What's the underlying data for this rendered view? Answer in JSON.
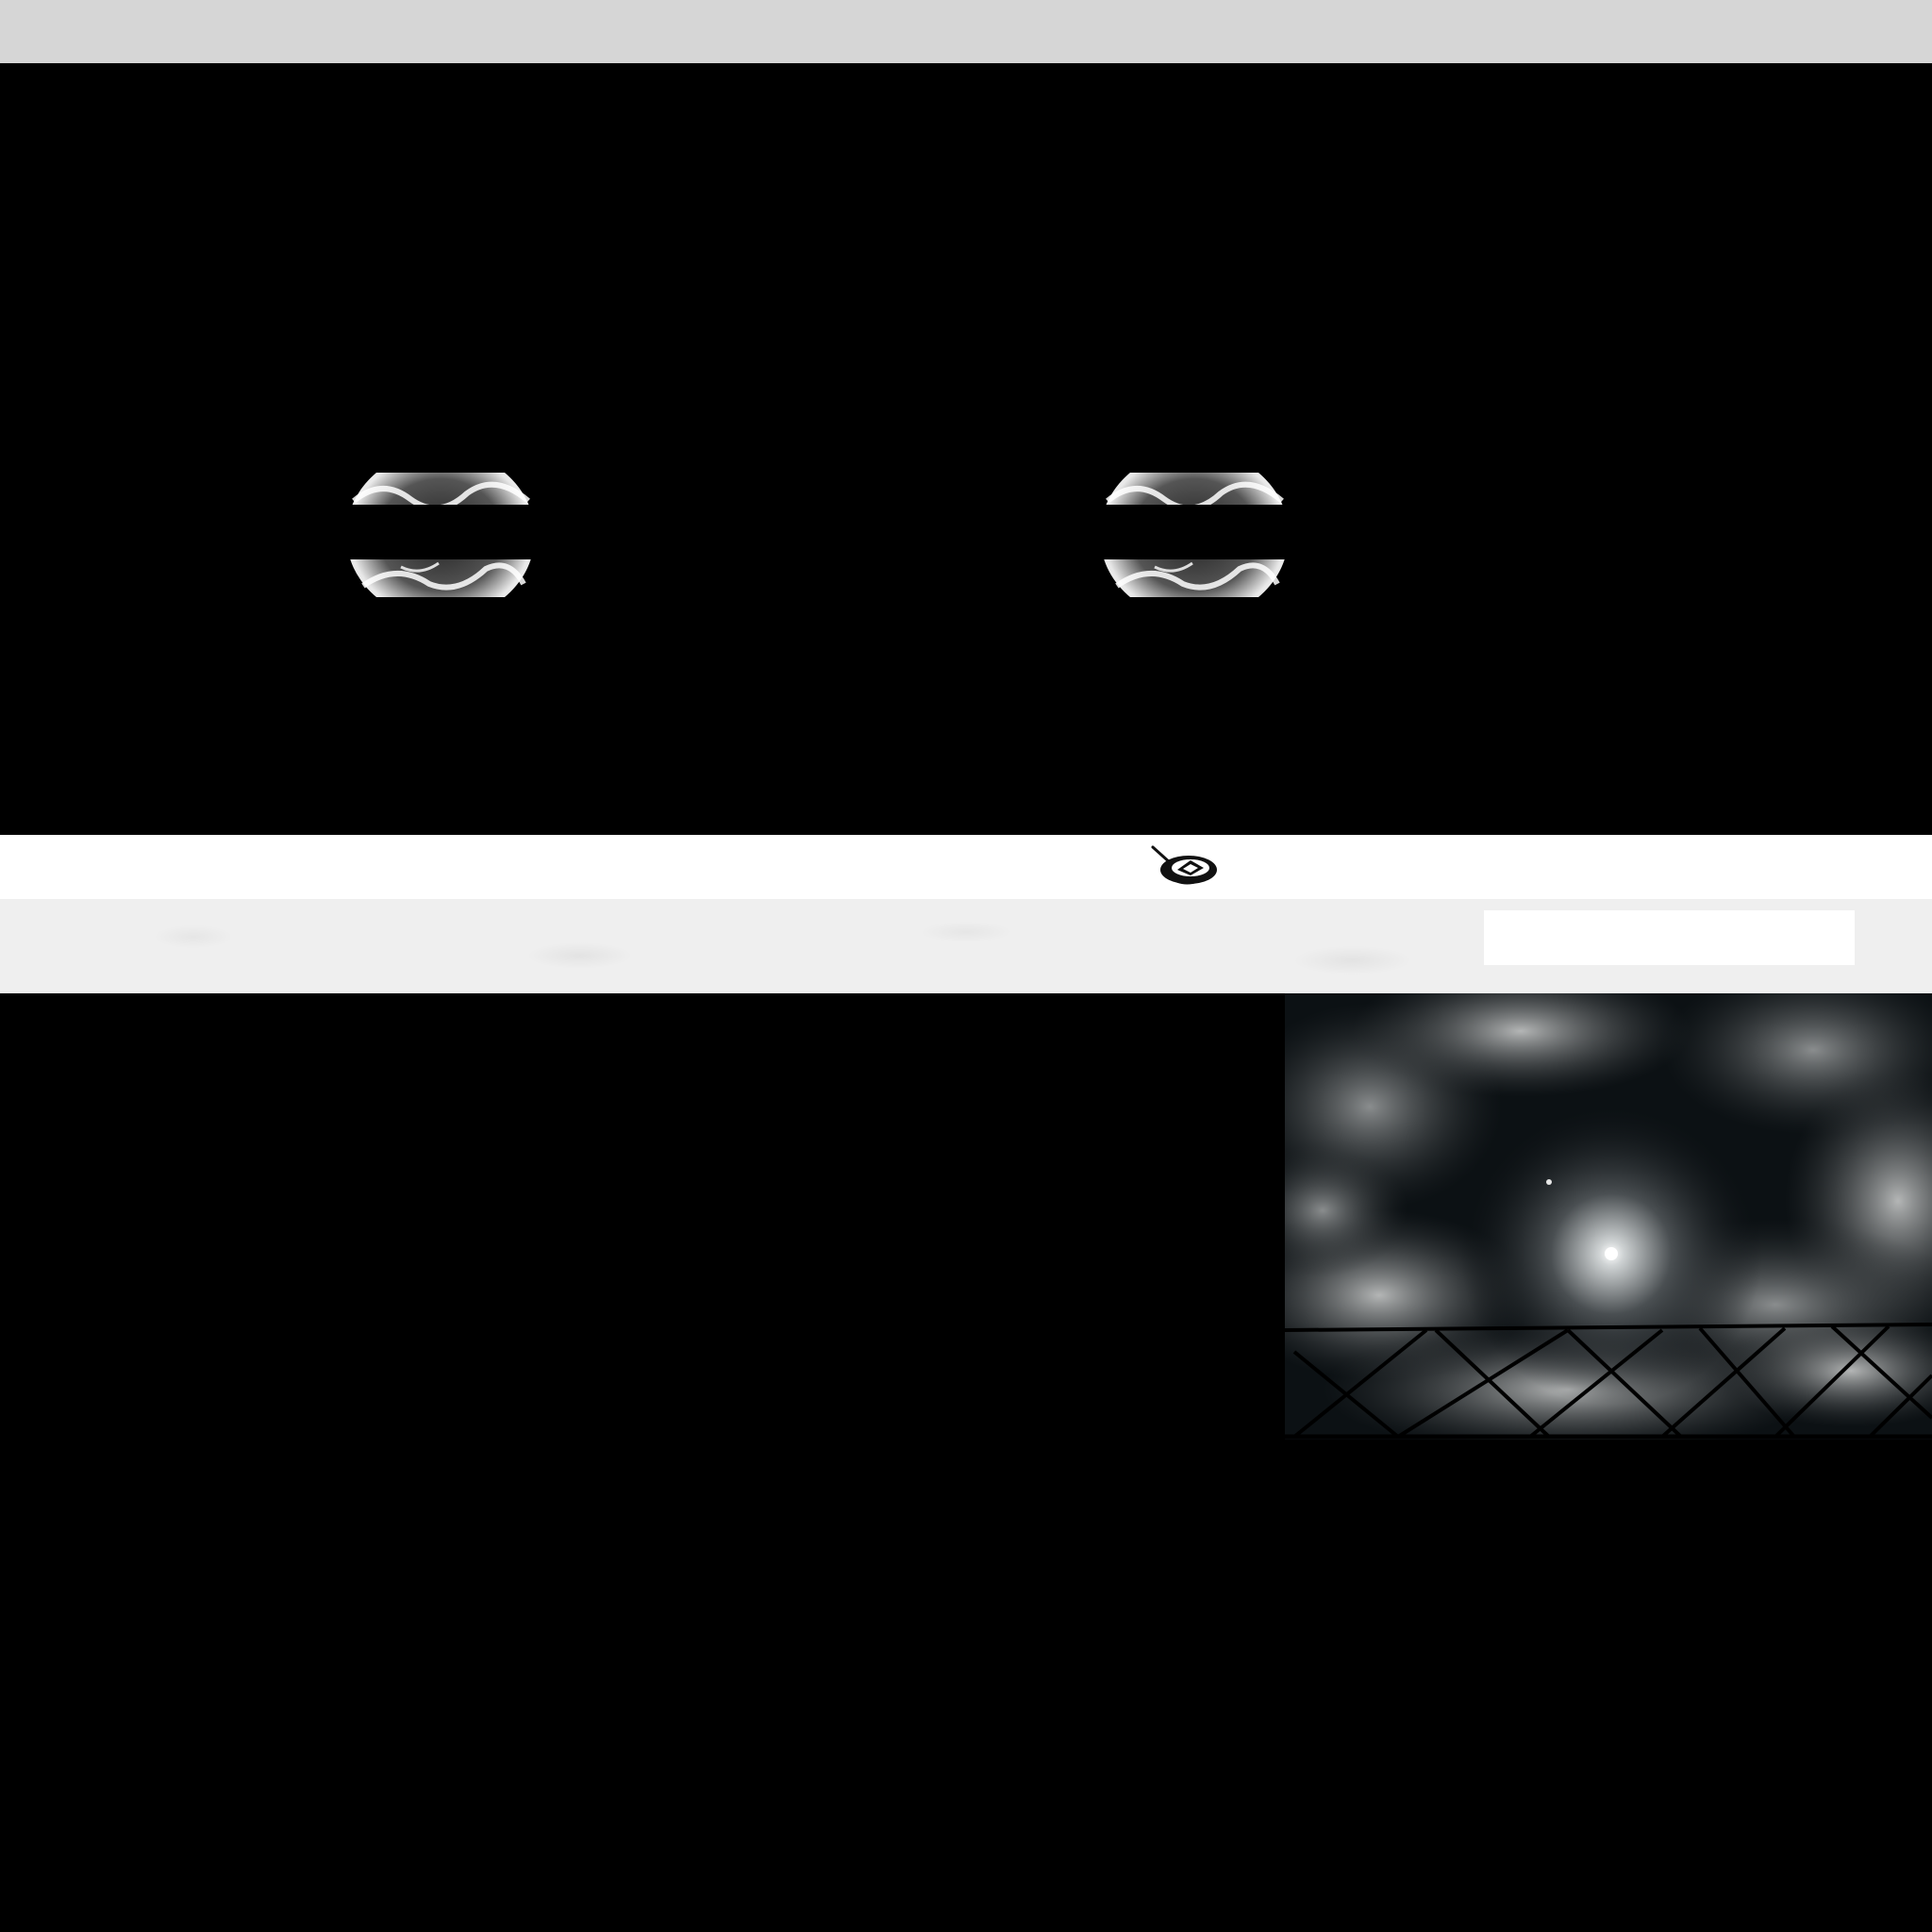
{
  "header": {
    "background_color": "#d6d6d6"
  },
  "hero": {
    "background_color": "#000000",
    "orbs": [
      {
        "icon": "glowing-orb-icon"
      },
      {
        "icon": "glowing-orb-icon"
      }
    ]
  },
  "logo": {
    "icon": "logo-icon"
  },
  "search": {
    "value": "",
    "placeholder": ""
  },
  "feature": {
    "image": "night-clouds-fence-image"
  },
  "colors": {
    "page_bg": "#000000",
    "logo_strip": "#ffffff",
    "texture_bar": "#efefef"
  }
}
